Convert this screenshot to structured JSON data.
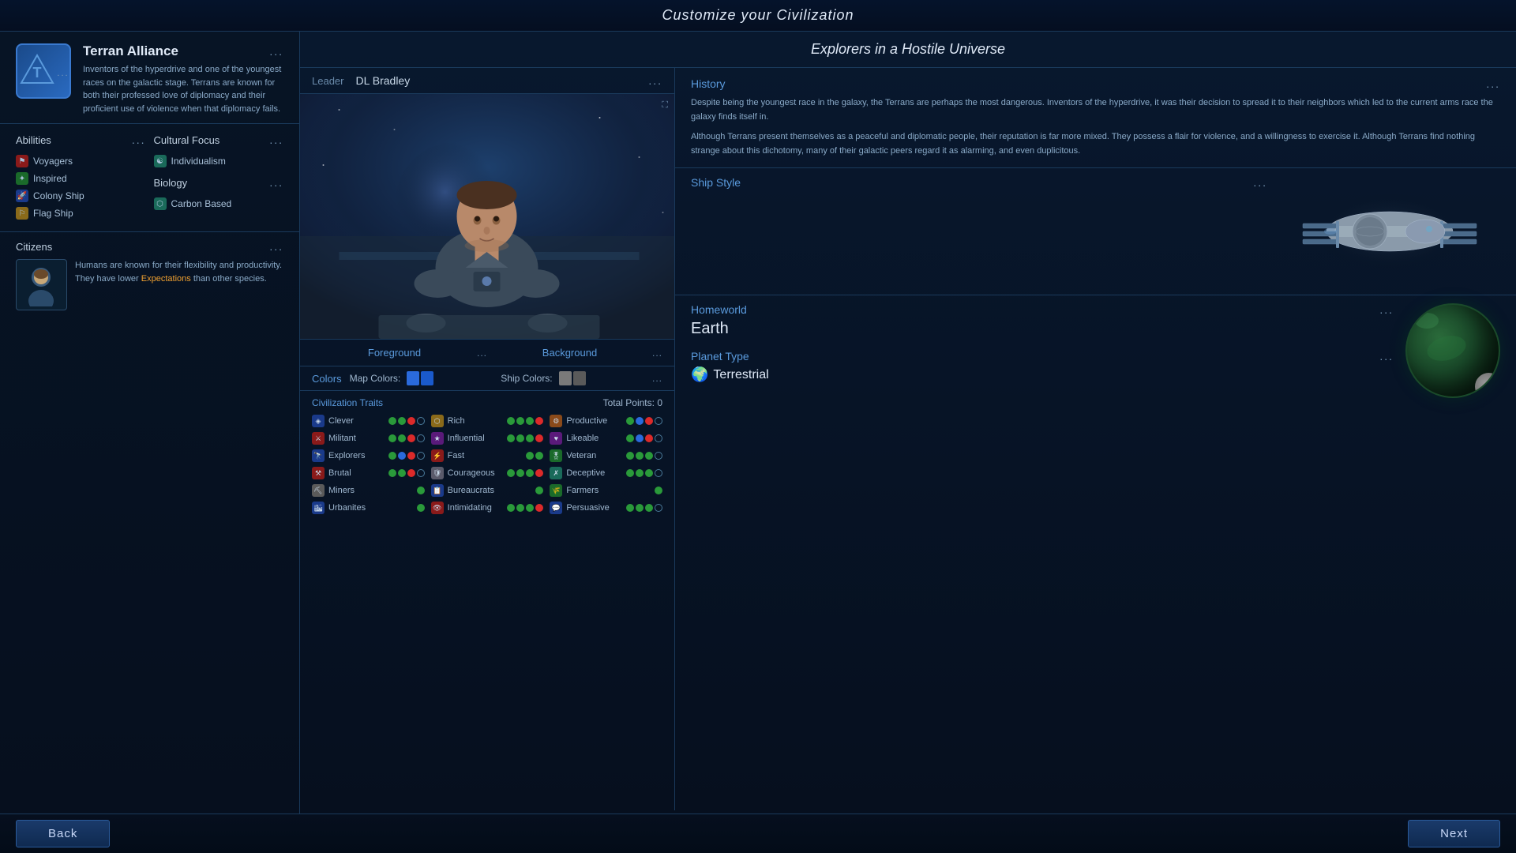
{
  "page": {
    "title": "Customize your Civilization"
  },
  "left_panel": {
    "civ_name": "Terran Alliance",
    "civ_dots": "...",
    "civ_desc": "Inventors of the hyperdrive and one of the youngest races on the galactic stage. Terrans are known for both their professed love of diplomacy and their proficient use of violence when that diplomacy fails.",
    "logo_dots": "...",
    "abilities_title": "Abilities",
    "abilities_dots": "...",
    "abilities": [
      {
        "name": "Voyagers",
        "icon_type": "red"
      },
      {
        "name": "Inspired",
        "icon_type": "green"
      },
      {
        "name": "Colony Ship",
        "icon_type": "blue"
      },
      {
        "name": "Flag Ship",
        "icon_type": "yellow"
      }
    ],
    "cultural_focus_title": "Cultural Focus",
    "cultural_focus_dots": "...",
    "cultural_items": [
      {
        "name": "Individualism",
        "icon_type": "teal"
      }
    ],
    "biology_label": "Biology",
    "biology_dots": "...",
    "biology_items": [
      {
        "name": "Carbon Based",
        "icon_type": "teal"
      }
    ],
    "citizens_title": "Citizens",
    "citizens_dots": "...",
    "citizen_desc": "Humans are known for their flexibility and productivity. They have lower",
    "citizen_link": "Expectations",
    "citizen_desc2": "than other species."
  },
  "main_panel": {
    "section_title": "Explorers in a Hostile Universe",
    "leader_label": "Leader",
    "leader_name": "DL Bradley",
    "leader_dots": "...",
    "portrait_expand": "⛶",
    "foreground_label": "Foreground",
    "foreground_dots": "...",
    "background_label": "Background",
    "background_dots": "...",
    "colors_label": "Colors",
    "colors_dots": "...",
    "map_colors_label": "Map Colors:",
    "ship_colors_label": "Ship Colors:",
    "traits_title": "Civilization Traits",
    "total_points_label": "Total Points:",
    "total_points_value": "0",
    "traits": [
      {
        "col": 1,
        "name": "Clever",
        "icon": "blue",
        "dots": [
          "g",
          "g",
          "r",
          "e"
        ]
      },
      {
        "col": 2,
        "name": "Rich",
        "icon": "yellow",
        "dots": [
          "g",
          "g",
          "g",
          "r"
        ]
      },
      {
        "col": 3,
        "name": "Productive",
        "icon": "orange",
        "dots": [
          "g",
          "b",
          "r",
          "e"
        ]
      },
      {
        "col": 1,
        "name": "Militant",
        "icon": "red",
        "dots": [
          "g",
          "g",
          "r",
          "e"
        ]
      },
      {
        "col": 2,
        "name": "Influential",
        "icon": "purple",
        "dots": [
          "g",
          "g",
          "g",
          "r"
        ]
      },
      {
        "col": 3,
        "name": "Likeable",
        "icon": "purple",
        "dots": [
          "g",
          "b",
          "r",
          "e"
        ]
      },
      {
        "col": 1,
        "name": "Explorers",
        "icon": "blue",
        "dots": [
          "g",
          "b",
          "r",
          "e"
        ]
      },
      {
        "col": 2,
        "name": "Fast",
        "icon": "red",
        "dots": [
          "g",
          "g"
        ]
      },
      {
        "col": 3,
        "name": "Veteran",
        "icon": "green",
        "dots": [
          "g",
          "g",
          "g",
          "e"
        ]
      },
      {
        "col": 1,
        "name": "Brutal",
        "icon": "red",
        "dots": [
          "g",
          "g",
          "r",
          "e"
        ]
      },
      {
        "col": 2,
        "name": "Courageous",
        "icon": "gray",
        "dots": [
          "g",
          "g",
          "g",
          "r"
        ]
      },
      {
        "col": 3,
        "name": "Deceptive",
        "icon": "teal",
        "dots": [
          "g",
          "g",
          "g",
          "e"
        ]
      },
      {
        "col": 1,
        "name": "Miners",
        "icon": "gray",
        "dots": [
          "g"
        ]
      },
      {
        "col": 2,
        "name": "Bureaucrats",
        "icon": "blue",
        "dots": [
          "g"
        ]
      },
      {
        "col": 3,
        "name": "Farmers",
        "icon": "green",
        "dots": [
          "g"
        ]
      },
      {
        "col": 1,
        "name": "Urbanites",
        "icon": "blue",
        "dots": [
          "g"
        ]
      },
      {
        "col": 2,
        "name": "Intimidating",
        "icon": "red",
        "dots": [
          "g",
          "g",
          "g",
          "r"
        ]
      },
      {
        "col": 3,
        "name": "Persuasive",
        "icon": "blue",
        "dots": [
          "g",
          "g",
          "g",
          "e"
        ]
      }
    ],
    "history_title": "History",
    "history_dots": "...",
    "history_p1": "Despite being the youngest race in the galaxy, the Terrans are perhaps the most dangerous. Inventors of the hyperdrive, it was their decision to spread it to their neighbors which led to the current arms race the galaxy finds itself in.",
    "history_p2": "Although Terrans present themselves as a peaceful and diplomatic people, their reputation is far more mixed. They possess a flair for violence, and a willingness to exercise it. Although Terrans find nothing strange about this dichotomy, many of their galactic peers regard it as alarming, and even duplicitous.",
    "ship_style_title": "Ship Style",
    "ship_style_dots": "...",
    "homeworld_title": "Homeworld",
    "homeworld_dots": "...",
    "homeworld_name": "Earth",
    "planet_type_title": "Planet Type",
    "planet_type_dots": "...",
    "planet_type_name": "Terrestrial",
    "planet_type_icon": "🌍"
  },
  "bottom": {
    "back_label": "Back",
    "next_label": "Next"
  }
}
